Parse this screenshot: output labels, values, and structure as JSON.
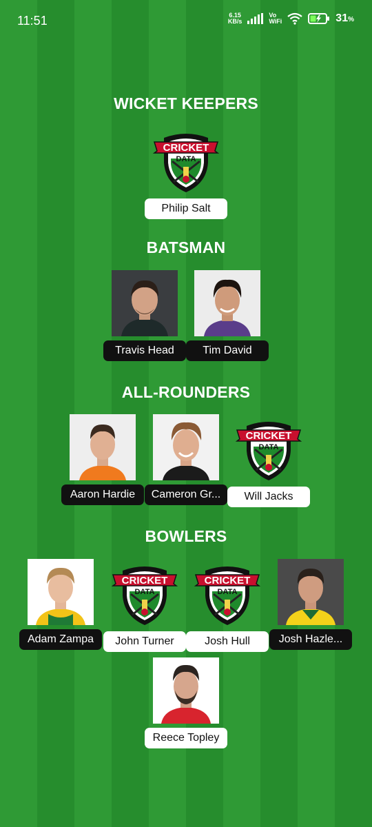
{
  "status": {
    "time": "11:51",
    "speed_value": "6.15",
    "speed_unit": "KB/s",
    "vo": "Vo",
    "wifi": "WiFi",
    "battery": "31",
    "percent": "%"
  },
  "logo": {
    "line1": "CRICKET",
    "line2": "DATA"
  },
  "sections": {
    "wicket_keepers": "WICKET KEEPERS",
    "batsman": "BATSMAN",
    "all_rounders": "ALL-ROUNDERS",
    "bowlers": "BOWLERS"
  },
  "players": {
    "philip_salt": "Philip Salt",
    "travis_head": "Travis Head",
    "tim_david": "Tim David",
    "aaron_hardie": "Aaron Hardie",
    "cameron_green": "Cameron Gr...",
    "will_jacks": "Will Jacks",
    "adam_zampa": "Adam Zampa",
    "john_turner": "John Turner",
    "josh_hull": "Josh Hull",
    "josh_hazlewood": "Josh Hazle...",
    "reece_topley": "Reece Topley"
  },
  "colors": {
    "field_light": "#2f9a35",
    "field_dark": "#268d2d",
    "logo_red": "#c8102e",
    "logo_green": "#1f8a2c"
  }
}
